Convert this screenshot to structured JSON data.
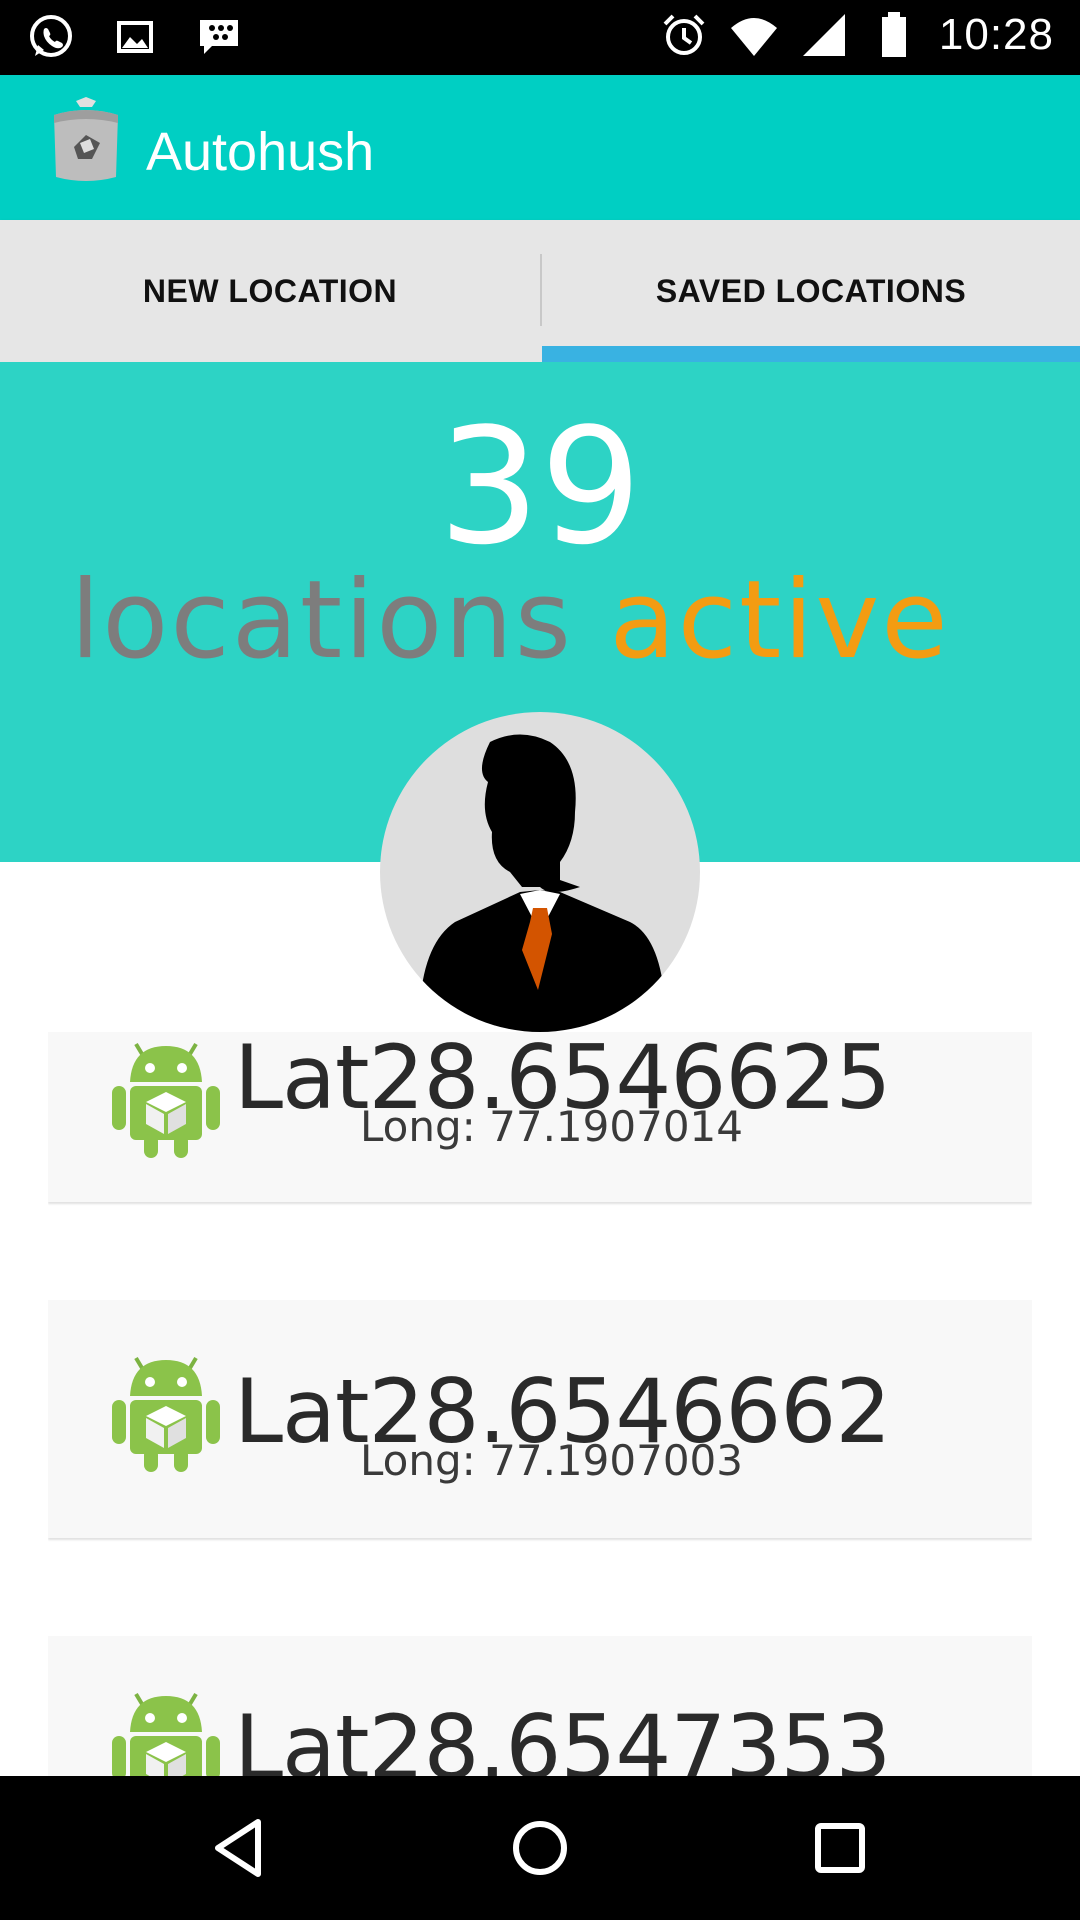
{
  "status_bar": {
    "left_icons": [
      "whatsapp-icon",
      "gallery-icon",
      "bbm-icon"
    ],
    "right_icons": [
      "alarm-icon",
      "wifi-icon",
      "signal-icon",
      "battery-icon"
    ],
    "time": "10:28"
  },
  "app_bar": {
    "title": "Autohush",
    "icon": "app-logo-icon"
  },
  "tabs": [
    {
      "label": "NEW LOCATION",
      "selected": false
    },
    {
      "label": "SAVED LOCATIONS",
      "selected": true
    }
  ],
  "hero": {
    "count": "39",
    "caption_word1": "locations",
    "caption_word2": "active"
  },
  "locations": [
    {
      "lat": "Lat28.6546625",
      "long": "Long: 77.1907014"
    },
    {
      "lat": "Lat28.6546662",
      "long": "Long: 77.1907003"
    },
    {
      "lat": "Lat28.6547353",
      "long": ""
    }
  ],
  "nav_bar": {
    "buttons": [
      "back-icon",
      "home-icon",
      "recents-icon"
    ]
  },
  "colors": {
    "app_bar": "#00cfc3",
    "hero": "#2dd3c5",
    "tab_indicator": "#39b2e2",
    "caption_gray": "#7d7d7d",
    "caption_orange": "#f39c12"
  }
}
